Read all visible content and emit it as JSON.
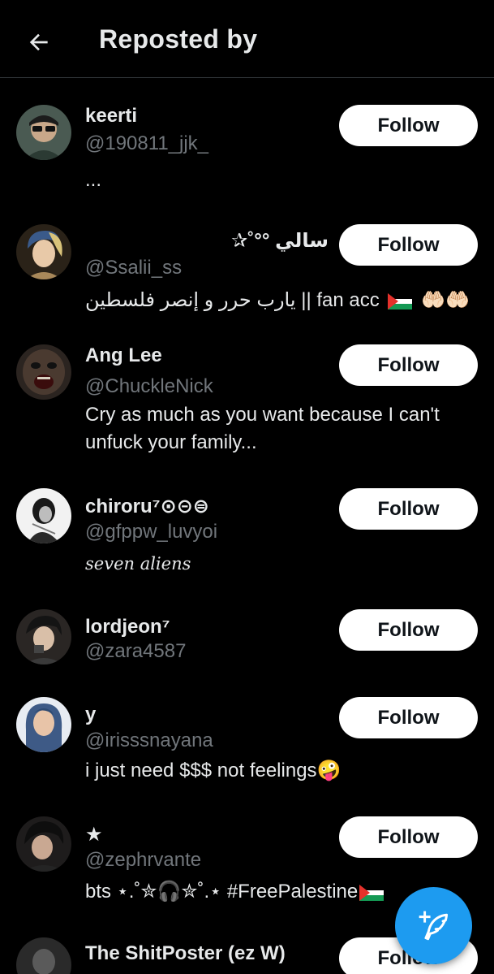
{
  "header": {
    "title": "Reposted by"
  },
  "colors": {
    "background": "#000000",
    "primary_text": "#e7e9ea",
    "secondary_text": "#71767b",
    "divider": "#2f3336",
    "follow_button_bg": "#ffffff",
    "follow_button_text": "#0f1419",
    "fab": "#1d9bf0"
  },
  "users": [
    {
      "name": "keerti",
      "handle": "@190811_jjk_",
      "bio": "...",
      "follow_label": "Follow",
      "avatar_icon": "avatar-photo"
    },
    {
      "name": "سالي °°˚✰",
      "handle": "@Ssalii_ss",
      "bio": "fan acc || يارب حرر و إنصر فلسطين",
      "bio_emoji": "🤲🏻🤲🏻",
      "follow_label": "Follow",
      "avatar_icon": "avatar-photo"
    },
    {
      "name": "Ang Lee",
      "handle": "@ChuckleNick",
      "bio": "Cry as much as you want because I can't unfuck your family...",
      "follow_label": "Follow",
      "avatar_icon": "avatar-photo"
    },
    {
      "name": "chiroru⁷⊙⊝⊜",
      "handle": "@gfppw_luvyoi",
      "bio": "seven aliens",
      "follow_label": "Follow",
      "avatar_icon": "avatar-photo"
    },
    {
      "name": "lordjeon⁷",
      "handle": "@zara4587",
      "bio": "",
      "follow_label": "Follow",
      "avatar_icon": "avatar-photo"
    },
    {
      "name": "y",
      "handle": "@irisssnayana",
      "bio": "i just need $$$ not feelings",
      "bio_emoji": "🤪",
      "follow_label": "Follow",
      "avatar_icon": "avatar-photo"
    },
    {
      "name": "★",
      "handle": "@zephrvante",
      "bio": "bts ⋆.˚✮🎧✮˚.⋆ #FreePalestine",
      "follow_label": "Follow",
      "avatar_icon": "avatar-photo"
    },
    {
      "name": "The ShitPoster (ez W)",
      "handle": "",
      "bio": "",
      "follow_label": "Follow",
      "avatar_icon": "avatar-photo"
    }
  ],
  "fab": {
    "icon": "compose-feather-plus-icon"
  }
}
